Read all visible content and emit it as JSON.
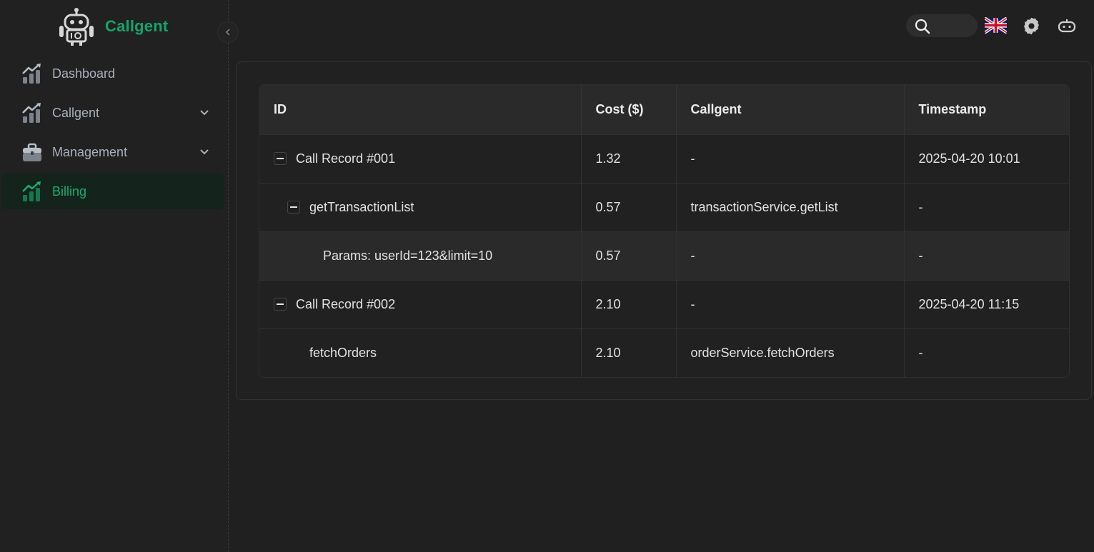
{
  "brand": {
    "name": "Callgent"
  },
  "sidebar": {
    "items": [
      {
        "label": "Dashboard",
        "icon": "chart-bars-icon",
        "expandable": false,
        "active": false
      },
      {
        "label": "Callgent",
        "icon": "chart-bars-icon",
        "expandable": true,
        "active": false
      },
      {
        "label": "Management",
        "icon": "briefcase-icon",
        "expandable": true,
        "active": false
      },
      {
        "label": "Billing",
        "icon": "chart-bars-icon",
        "expandable": false,
        "active": true
      }
    ]
  },
  "header": {
    "icons": [
      "search-icon",
      "uk-flag-icon",
      "settings-icon",
      "bot-icon"
    ]
  },
  "table": {
    "columns": [
      "ID",
      "Cost ($)",
      "Callgent",
      "Timestamp"
    ],
    "rows": [
      {
        "level": 0,
        "toggle": true,
        "id": "Call Record #001",
        "cost": "1.32",
        "callgent": "-",
        "timestamp": "2025-04-20 10:01",
        "highlight": false
      },
      {
        "level": 1,
        "toggle": true,
        "id": "getTransactionList",
        "cost": "0.57",
        "callgent": "transactionService.getList",
        "timestamp": "-",
        "highlight": false
      },
      {
        "level": 2,
        "toggle": false,
        "id": "Params: userId=123&limit=10",
        "cost": "0.57",
        "callgent": "-",
        "timestamp": "-",
        "highlight": true
      },
      {
        "level": 0,
        "toggle": true,
        "id": "Call Record #002",
        "cost": "2.10",
        "callgent": "-",
        "timestamp": "2025-04-20 11:15",
        "highlight": false
      },
      {
        "level": 1,
        "toggle": false,
        "id": "fetchOrders",
        "cost": "2.10",
        "callgent": "orderService.fetchOrders",
        "timestamp": "-",
        "highlight": false
      }
    ]
  },
  "colors": {
    "accent": "#16a36a",
    "background": "#202020",
    "header_row": "#2a2a2a"
  }
}
